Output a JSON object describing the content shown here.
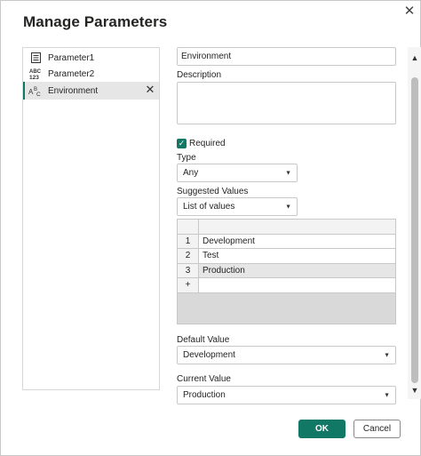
{
  "dialog": {
    "title": "Manage Parameters",
    "close_glyph": "✕"
  },
  "parameters": [
    {
      "label": "Parameter1",
      "icon": "list-icon"
    },
    {
      "label": "Parameter2",
      "icon": "abc-123-icon"
    },
    {
      "label": "Environment",
      "icon": "abc-icon",
      "selected": true
    }
  ],
  "form": {
    "name_value": "Environment",
    "description_label": "Description",
    "description_value": "",
    "required_label": "Required",
    "required_checked": true,
    "type_label": "Type",
    "type_value": "Any",
    "suggested_label": "Suggested Values",
    "suggested_value": "List of values",
    "values_grid": {
      "rows": [
        {
          "num": "1",
          "value": "Development"
        },
        {
          "num": "2",
          "value": "Test"
        },
        {
          "num": "3",
          "value": "Production"
        }
      ],
      "new_row_marker": "+"
    },
    "default_label": "Default Value",
    "default_value": "Development",
    "current_label": "Current Value",
    "current_value": "Production"
  },
  "buttons": {
    "ok": "OK",
    "cancel": "Cancel"
  },
  "colors": {
    "accent": "#117865"
  }
}
